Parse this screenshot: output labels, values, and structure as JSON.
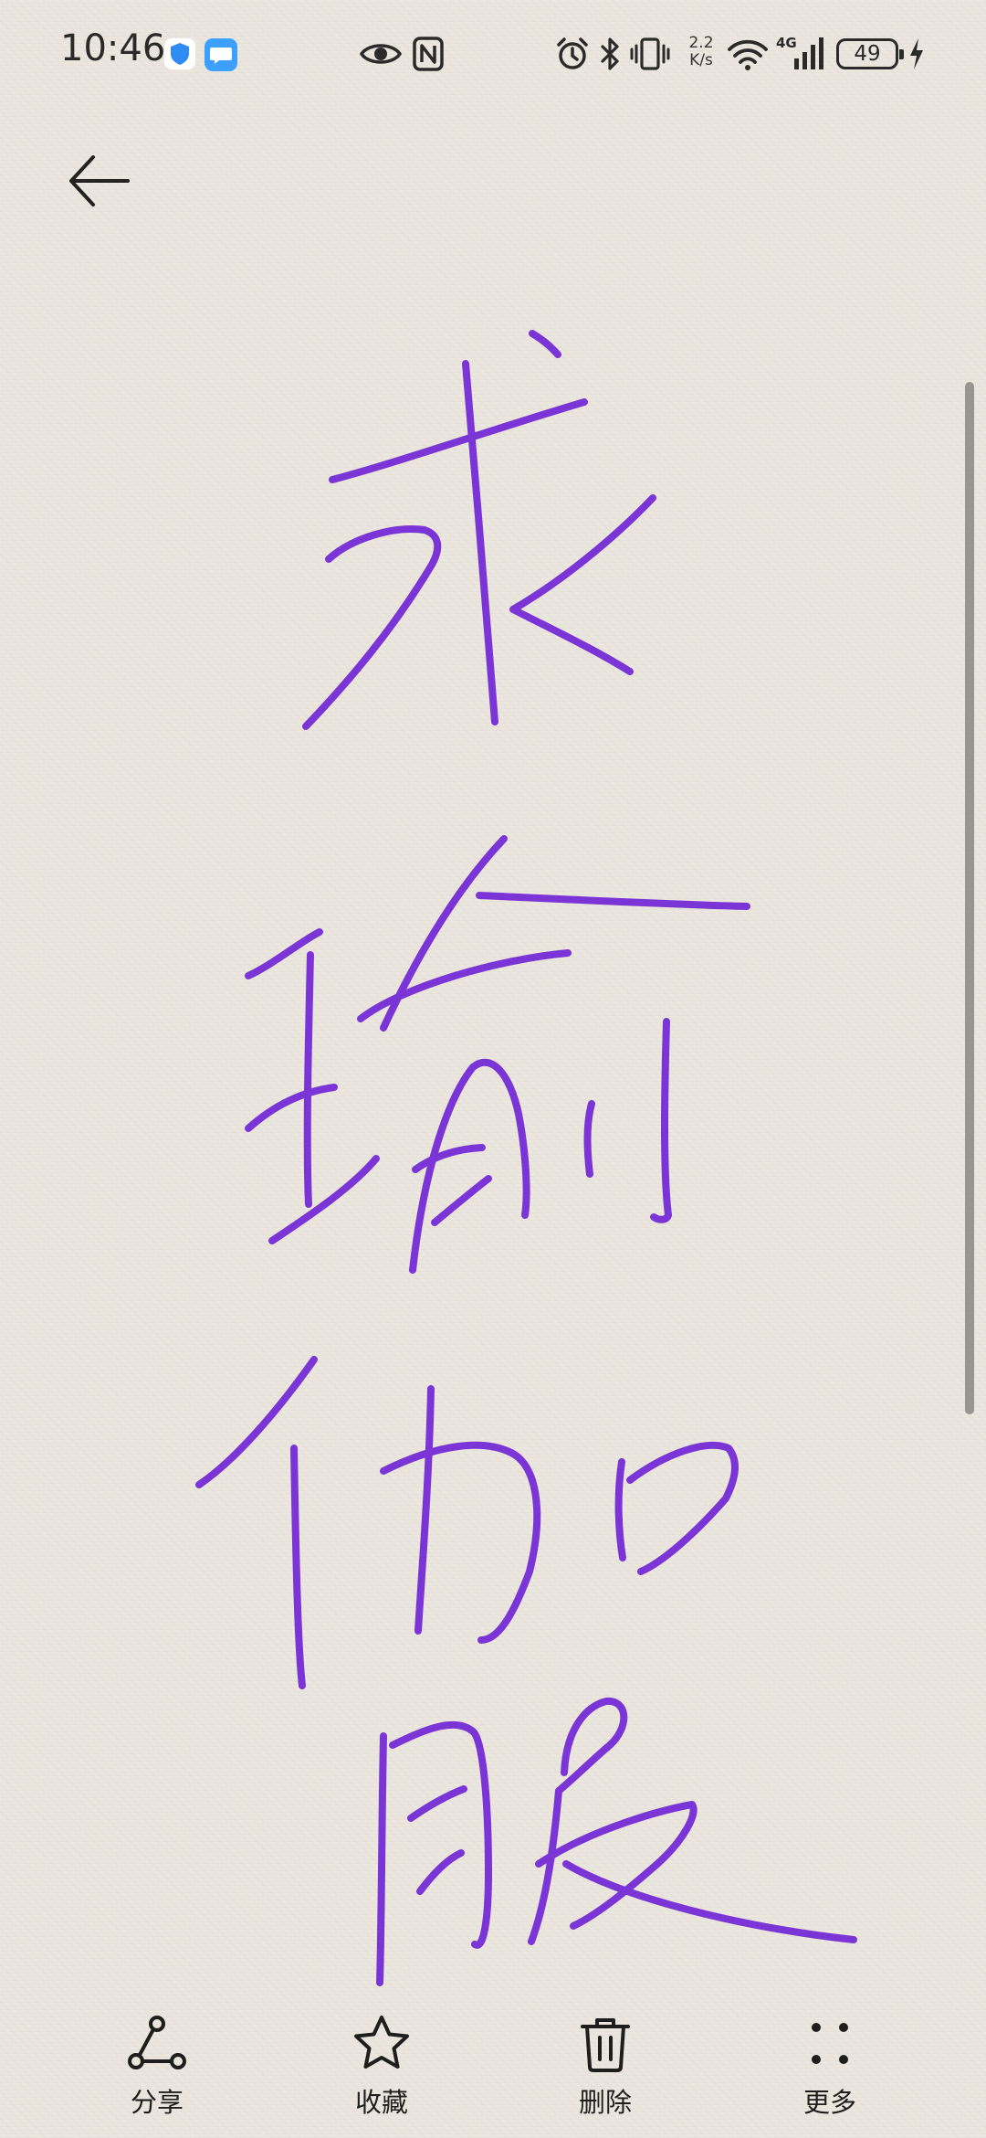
{
  "status_bar": {
    "time": "10:46",
    "net_speed_value": "2.2",
    "net_speed_unit": "K/s",
    "network_type": "4G",
    "battery_level": "49",
    "notification_icons": [
      "shield-app-icon",
      "message-app-icon"
    ],
    "system_icons": [
      "eye-icon",
      "nfc-icon",
      "alarm-icon",
      "bluetooth-icon",
      "vibrate-icon",
      "wifi-icon",
      "signal-icon",
      "charging-icon"
    ]
  },
  "header": {
    "back_icon": "arrow-left-icon"
  },
  "note": {
    "content_type": "handwriting",
    "ink_color": "#7b35d6",
    "characters": [
      "求",
      "瑜",
      "伽",
      "服"
    ]
  },
  "toolbar": {
    "items": [
      {
        "label": "分享",
        "icon": "share-icon"
      },
      {
        "label": "收藏",
        "icon": "star-icon"
      },
      {
        "label": "删除",
        "icon": "trash-icon"
      },
      {
        "label": "更多",
        "icon": "more-icon"
      }
    ]
  },
  "colors": {
    "background": "#ebe6de",
    "ink": "#7b35d6",
    "icon": "#1e1e1e"
  }
}
